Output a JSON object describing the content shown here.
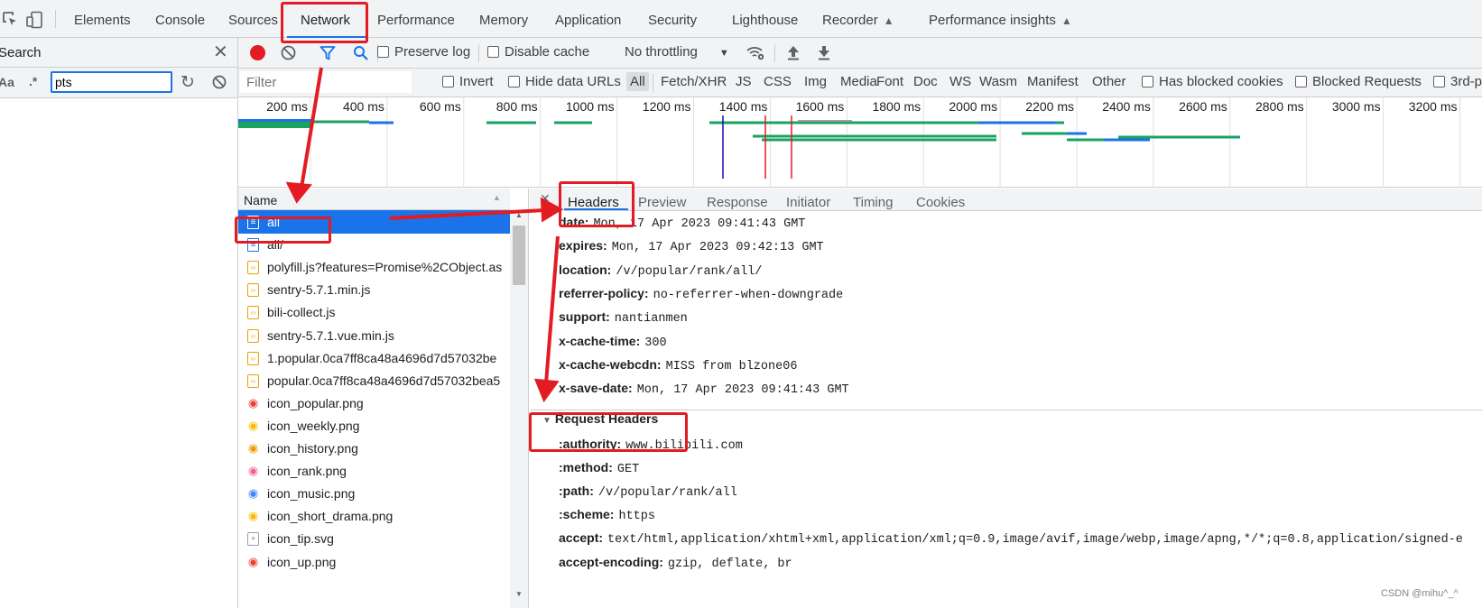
{
  "main_tabs": [
    "Elements",
    "Console",
    "Sources",
    "Network",
    "Performance",
    "Memory",
    "Application",
    "Security",
    "Lighthouse",
    "Recorder",
    "Performance insights"
  ],
  "search": {
    "title": "Search",
    "case_label": "Aa",
    "regex_label": ".*",
    "query": "pts"
  },
  "toolbar": {
    "preserve_log": "Preserve log",
    "disable_cache": "Disable cache",
    "throttling": "No throttling"
  },
  "filter": {
    "placeholder": "Filter",
    "invert": "Invert",
    "hide_data_urls": "Hide data URLs",
    "types": [
      "All",
      "Fetch/XHR",
      "JS",
      "CSS",
      "Img",
      "Media",
      "Font",
      "Doc",
      "WS",
      "Wasm",
      "Manifest",
      "Other"
    ],
    "has_blocked_cookies": "Has blocked cookies",
    "blocked_requests": "Blocked Requests",
    "third_party": "3rd-p"
  },
  "timeline_ticks": [
    "200 ms",
    "400 ms",
    "600 ms",
    "800 ms",
    "1000 ms",
    "1200 ms",
    "1400 ms",
    "1600 ms",
    "1800 ms",
    "2000 ms",
    "2200 ms",
    "2400 ms",
    "2600 ms",
    "2800 ms",
    "3000 ms",
    "3200 ms"
  ],
  "colors": {
    "red_accent": "#e31b23",
    "selection_blue": "#1a73e8",
    "timeline_green": "#1aa260",
    "timeline_blue": "#1a73e8"
  },
  "request_list": {
    "header": "Name",
    "items": [
      {
        "name": "all",
        "icon": "document-icon"
      },
      {
        "name": "all/",
        "icon": "document-icon"
      },
      {
        "name": "polyfill.js?features=Promise%2CObject.as",
        "icon": "script-icon"
      },
      {
        "name": "sentry-5.7.1.min.js",
        "icon": "script-icon"
      },
      {
        "name": "bili-collect.js",
        "icon": "script-icon"
      },
      {
        "name": "sentry-5.7.1.vue.min.js",
        "icon": "script-icon"
      },
      {
        "name": "1.popular.0ca7ff8ca48a4696d7d57032be",
        "icon": "script-icon"
      },
      {
        "name": "popular.0ca7ff8ca48a4696d7d57032bea5",
        "icon": "script-icon"
      },
      {
        "name": "icon_popular.png",
        "icon": "image-icon"
      },
      {
        "name": "icon_weekly.png",
        "icon": "image-icon"
      },
      {
        "name": "icon_history.png",
        "icon": "image-icon"
      },
      {
        "name": "icon_rank.png",
        "icon": "image-icon"
      },
      {
        "name": "icon_music.png",
        "icon": "image-icon"
      },
      {
        "name": "icon_short_drama.png",
        "icon": "image-icon"
      },
      {
        "name": "icon_tip.svg",
        "icon": "svg-icon"
      },
      {
        "name": "icon_up.png",
        "icon": "image-icon"
      }
    ]
  },
  "details": {
    "tabs": [
      "Headers",
      "Preview",
      "Response",
      "Initiator",
      "Timing",
      "Cookies"
    ],
    "response_headers": [
      {
        "name": "date:",
        "value": "Mon, 17 Apr 2023 09:41:43 GMT"
      },
      {
        "name": "expires:",
        "value": "Mon, 17 Apr 2023 09:42:13 GMT"
      },
      {
        "name": "location:",
        "value": "/v/popular/rank/all/"
      },
      {
        "name": "referrer-policy:",
        "value": "no-referrer-when-downgrade"
      },
      {
        "name": "support:",
        "value": "nantianmen"
      },
      {
        "name": "x-cache-time:",
        "value": "300"
      },
      {
        "name": "x-cache-webcdn:",
        "value": "MISS from blzone06"
      },
      {
        "name": "x-save-date:",
        "value": "Mon, 17 Apr 2023 09:41:43 GMT"
      }
    ],
    "request_headers_title": "Request Headers",
    "request_headers": [
      {
        "name": ":authority:",
        "value": "www.bilibili.com"
      },
      {
        "name": ":method:",
        "value": "GET"
      },
      {
        "name": ":path:",
        "value": "/v/popular/rank/all"
      },
      {
        "name": ":scheme:",
        "value": "https"
      },
      {
        "name": "accept:",
        "value": "text/html,application/xhtml+xml,application/xml;q=0.9,image/avif,image/webp,image/apng,*/*;q=0.8,application/signed-e"
      },
      {
        "name": "accept-encoding:",
        "value": "gzip, deflate, br"
      }
    ]
  },
  "watermark": "CSDN @mihu^_^"
}
